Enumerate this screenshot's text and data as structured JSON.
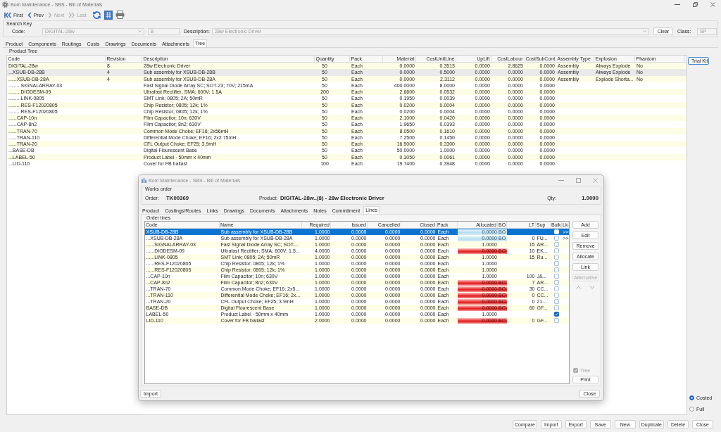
{
  "window": {
    "title": "Bom Maintenance - SBS - Bill of Materials"
  },
  "toolbar": [
    {
      "kind": "first",
      "label": "First",
      "disabled": false
    },
    {
      "kind": "prev",
      "label": "Prev",
      "disabled": false
    },
    {
      "kind": "next",
      "label": "Next",
      "disabled": true
    },
    {
      "kind": "last",
      "label": "Last",
      "disabled": true
    }
  ],
  "search_key": {
    "title": "Search Key",
    "code": {
      "label": "Code:",
      "value": "DIGITAL-28w",
      "disabled": true
    },
    "revision": {
      "value": "8",
      "disabled": true
    },
    "description": {
      "label": "Description:",
      "value": "28w Electronic Driver",
      "disabled": true
    },
    "clear_button": "Clear",
    "class": {
      "label": "Class:",
      "value": "SP",
      "disabled": true
    }
  },
  "tabs": [
    {
      "label": "Product",
      "selected": false
    },
    {
      "label": "Components",
      "selected": false
    },
    {
      "label": "Routings",
      "selected": false
    },
    {
      "label": "Costs",
      "selected": false
    },
    {
      "label": "Drawings",
      "selected": false
    },
    {
      "label": "Documents",
      "selected": false
    },
    {
      "label": "Attachments",
      "selected": false
    },
    {
      "label": "Tree",
      "selected": true
    }
  ],
  "product_tree": {
    "title": "Product Tree",
    "columns": [
      "Code",
      "Revision",
      "Description",
      "Quantity",
      "Pack",
      "Material",
      "CostUnitLine",
      "UpLift",
      "CostLabour",
      "CostSubCont",
      "Assembly Type",
      "Explosion",
      "Phantom"
    ],
    "rows": [
      {
        "code": "DIGITAL-28w",
        "revision": "8",
        "description": "28w Electronic Driver",
        "quantity": "50",
        "pack": "Each",
        "material": "0.0000",
        "cost_unit_line": "0.3513",
        "uplift": "0.0000",
        "cost_labour": "2.8625",
        "cost_sub_contract": "0.0000",
        "assembly_type": "Assembly",
        "explosion": "Always Explode",
        "phantom": "No",
        "selected": false,
        "children": [
          {
            "code": "...XSUB-DB-28B",
            "revision": "4",
            "description": "Sub assembly for XSUB-DB-28B",
            "quantity": "50",
            "pack": "Each",
            "material": "0.0000",
            "cost_unit_line": "0.5000",
            "uplift": "0.0000",
            "cost_labour": "0.0000",
            "cost_sub_contract": "0.0000",
            "assembly_type": "Assembly",
            "explosion": "Always Explode",
            "phantom": "No",
            "selected": true,
            "children": [
              {
                "code": "......XSUB-DB-28A",
                "revision": "4",
                "description": "Sub assembly for XSUB-DB-28A",
                "quantity": "50",
                "pack": "Each",
                "material": "0.0000",
                "cost_unit_line": "2.3112",
                "uplift": "0.0000",
                "cost_labour": "0.0000",
                "cost_sub_contract": "0.0000",
                "assembly_type": "Assembly",
                "explosion": "Explode Shorta...",
                "phantom": "No",
                "selected": false,
                "children": [
                  {
                    "code": ".........SIGNALARRAY-03",
                    "description": "Fast Signal Diode Array SC; SOT-23; 70V; 215mA",
                    "quantity": "50",
                    "pack": "Each",
                    "material": "400.0000",
                    "cost_unit_line": "8.0000",
                    "uplift": "0.0000",
                    "cost_labour": "0.0000",
                    "cost_sub_contract": "0.0000",
                    "selected": false
                  },
                  {
                    "code": ".........DIODESM-09",
                    "description": "Ultrafast Rectifier; SMA; 600V; 1.5A",
                    "quantity": "200",
                    "pack": "Each",
                    "material": "2.6600",
                    "cost_unit_line": "0.0532",
                    "uplift": "0.0000",
                    "cost_labour": "0.0000",
                    "cost_sub_contract": "0.0000",
                    "selected": false
                  },
                  {
                    "code": ".........LINK-0805",
                    "description": "SMT Link; 0805; 2A; 50mR",
                    "quantity": "50",
                    "pack": "Each",
                    "material": "0.1950",
                    "cost_unit_line": "0.0039",
                    "uplift": "0.0000",
                    "cost_labour": "0.0000",
                    "cost_sub_contract": "0.0000",
                    "selected": false
                  },
                  {
                    "code": ".........RES-F12020805",
                    "description": "Chip Resistor; 0805; 12k; 1%",
                    "quantity": "50",
                    "pack": "Each",
                    "material": "0.0200",
                    "cost_unit_line": "0.0004",
                    "uplift": "0.0000",
                    "cost_labour": "0.0000",
                    "cost_sub_contract": "0.0000",
                    "selected": false
                  },
                  {
                    "code": ".........RES-F12020805",
                    "description": "Chip Resistor; 0805; 12k; 1%",
                    "quantity": "50",
                    "pack": "Each",
                    "material": "0.0200",
                    "cost_unit_line": "0.0004",
                    "uplift": "0.0000",
                    "cost_labour": "0.0000",
                    "cost_sub_contract": "0.0000",
                    "selected": false
                  }
                ]
              },
              {
                "code": "......CAP-10n",
                "description": "Film Capacitor; 10n; 630V",
                "quantity": "50",
                "pack": "Each",
                "material": "2.1000",
                "cost_unit_line": "0.0420",
                "uplift": "0.0000",
                "cost_labour": "0.0000",
                "cost_sub_contract": "0.0000",
                "selected": false
              },
              {
                "code": "......CAP-8n2",
                "description": "Film Capacitor; 8n2; 630V",
                "quantity": "50",
                "pack": "Each",
                "material": "1.9650",
                "cost_unit_line": "0.0393",
                "uplift": "0.0000",
                "cost_labour": "0.0000",
                "cost_sub_contract": "0.0000",
                "selected": false
              },
              {
                "code": "......TRAN-70",
                "description": "Common Mode Choke; EF16; 2x56mH",
                "quantity": "50",
                "pack": "Each",
                "material": "8.0500",
                "cost_unit_line": "0.1610",
                "uplift": "0.0000",
                "cost_labour": "0.0000",
                "cost_sub_contract": "0.0000",
                "selected": false
              },
              {
                "code": "......TRAN-110",
                "description": "Differential Mode Choke; EF16; 2x2.75mH",
                "quantity": "50",
                "pack": "Each",
                "material": "7.2500",
                "cost_unit_line": "0.1450",
                "uplift": "0.0000",
                "cost_labour": "0.0000",
                "cost_sub_contract": "0.0000",
                "selected": false
              },
              {
                "code": "......TRAN-20",
                "description": "CFL Output Choke; EF25; 3.9mH",
                "quantity": "50",
                "pack": "Each",
                "material": "16.5000",
                "cost_unit_line": "0.3300",
                "uplift": "0.0000",
                "cost_labour": "0.0000",
                "cost_sub_contract": "0.0000",
                "selected": false
              }
            ]
          },
          {
            "code": "...BASE-DB",
            "description": "Digital Flourescent Base",
            "quantity": "50",
            "pack": "Each",
            "material": "50.0000",
            "cost_unit_line": "1.0000",
            "uplift": "0.0000",
            "cost_labour": "0.0000",
            "cost_sub_contract": "0.0000",
            "selected": false
          },
          {
            "code": "...LABEL-50",
            "description": "Product Label - 50mm x 40mm",
            "quantity": "50",
            "pack": "Each",
            "material": "0.3050",
            "cost_unit_line": "0.0061",
            "uplift": "0.0000",
            "cost_labour": "0.0000",
            "cost_sub_contract": "0.0000",
            "selected": false
          },
          {
            "code": "...LID-110",
            "description": "Cover for FB ballast",
            "quantity": "100",
            "pack": "Each",
            "material": "19.7400",
            "cost_unit_line": "0.3948",
            "uplift": "0.0000",
            "cost_labour": "0.0000",
            "cost_sub_contract": "0.0000",
            "selected": false
          }
        ]
      }
    ]
  },
  "trial_kit_button": "Trial Kit",
  "view_options": [
    {
      "label": "Costed",
      "selected": true
    },
    {
      "label": "Full",
      "selected": false
    }
  ],
  "bottom_buttons": [
    "Compare",
    "Import",
    "Export",
    "Save",
    "New",
    "Duplicate",
    "Delete",
    "Close"
  ],
  "dialog": {
    "title": "Bom Maintenance - SBS - Bill of Materials",
    "works_order": {
      "title": "Works order",
      "order_label": "Order:",
      "order": "TK00369",
      "product_label": "Product:",
      "product": "DIGITAL-28w..(8) - 28w Electronic Driver",
      "qty_label": "Qty:",
      "qty": "1.0000"
    },
    "tabs": [
      {
        "label": "Product",
        "selected": false
      },
      {
        "label": "Costings/Routes",
        "selected": false
      },
      {
        "label": "Links",
        "selected": false
      },
      {
        "label": "Drawings",
        "selected": false
      },
      {
        "label": "Documents",
        "selected": false
      },
      {
        "label": "Attachments",
        "selected": false
      },
      {
        "label": "Notes",
        "selected": false
      },
      {
        "label": "Commitment",
        "selected": false
      },
      {
        "label": "Lines",
        "selected": true
      }
    ],
    "order_lines": {
      "title": "Order lines",
      "columns": [
        "Code",
        "Name",
        "Required",
        "Issued",
        "Cancelled",
        "Closed",
        "Pack",
        "Allocated",
        "BO",
        "LT",
        "Sup",
        "Bulk",
        "Lk"
      ],
      "rows": [
        {
          "kind": "works_order",
          "code": "XSUB-DB-28B",
          "name": "Sub assembly for XSUB-DB-28B",
          "required": "1.0000",
          "issued": "0.0000",
          "cancelled": "0.0000",
          "closed": "0.0000",
          "pack": "Each",
          "allocated": "0.0000",
          "bo": "BO",
          "bulk": false,
          "link": ">>",
          "selected": true,
          "children": [
            {
              "kind": "works_order",
              "code": "...XSUB-DB-28A",
              "name": "Sub assembly for XSUB-DB-28A",
              "required": "1.0000",
              "issued": "0.0000",
              "cancelled": "0.0000",
              "closed": "0.0000",
              "pack": "Each",
              "allocated": "0.0000",
              "bo": "BO",
              "lead_time": "0",
              "supplier": "FU...",
              "bulk": false,
              "link": ">>",
              "selected": false,
              "children": [
                {
                  "kind": "plain",
                  "code": "......SIGNALARRAY-03",
                  "name": "Fast Signal Diode Array SC; SOT-...",
                  "required": "1.0000",
                  "issued": "0.0000",
                  "cancelled": "0.0000",
                  "closed": "0.0000",
                  "pack": "Each",
                  "allocated": "1.0000",
                  "lead_time": "15",
                  "supplier": "AR...",
                  "bulk": false,
                  "selected": false
                },
                {
                  "kind": "backorder",
                  "code": "......DIODESM-09",
                  "name": "Ultrafast Rectifier; SMA; 600V; 1.5...",
                  "required": "4.0000",
                  "issued": "0.0000",
                  "cancelled": "0.0000",
                  "closed": "0.0000",
                  "pack": "Each",
                  "allocated": "0.0000",
                  "bo": "BO",
                  "lead_time": "10",
                  "supplier": "EK...",
                  "bulk": false,
                  "selected": false
                },
                {
                  "kind": "plain",
                  "code": "......LINK-0805",
                  "name": "SMT Link; 0805; 2A; 50mR",
                  "required": "1.0000",
                  "issued": "0.0000",
                  "cancelled": "0.0000",
                  "closed": "0.0000",
                  "pack": "Each",
                  "allocated": "1.0000",
                  "lead_time": "15",
                  "supplier": "Ru...",
                  "bulk": false,
                  "selected": false
                },
                {
                  "kind": "plain",
                  "code": "......RES-F12020805",
                  "name": "Chip Resistor; 0805; 12k; 1%",
                  "required": "1.0000",
                  "issued": "0.0000",
                  "cancelled": "0.0000",
                  "closed": "0.0000",
                  "pack": "Each",
                  "allocated": "1.0000",
                  "bulk": false,
                  "selected": false
                },
                {
                  "kind": "plain",
                  "code": "......RES-F12020805",
                  "name": "Chip Resistor; 0805; 12k; 1%",
                  "required": "1.0000",
                  "issued": "0.0000",
                  "cancelled": "0.0000",
                  "closed": "0.0000",
                  "pack": "Each",
                  "allocated": "1.0000",
                  "bulk": false,
                  "selected": false
                }
              ]
            },
            {
              "kind": "plain",
              "code": "...CAP-10n",
              "name": "Film Capacitor; 10n; 630V",
              "required": "1.0000",
              "issued": "0.0000",
              "cancelled": "0.0000",
              "closed": "0.0000",
              "pack": "Each",
              "allocated": "1.0000",
              "lead_time": "100",
              "supplier": "J&...",
              "bulk": false,
              "selected": false
            },
            {
              "kind": "backorder",
              "code": "...CAP-8n2",
              "name": "Film Capacitor; 8n2; 630V",
              "required": "1.0000",
              "issued": "0.0000",
              "cancelled": "0.0000",
              "closed": "0.0000",
              "pack": "Each",
              "allocated": "0.0000",
              "bo": "BO",
              "lead_time": "7",
              "supplier": "AR...",
              "bulk": false,
              "selected": false
            },
            {
              "kind": "backorder",
              "code": "...TRAN-70",
              "name": "Common Mode Choke; EF16; 2x5...",
              "required": "1.0000",
              "issued": "0.0000",
              "cancelled": "0.0000",
              "closed": "0.0000",
              "pack": "Each",
              "allocated": "0.0000",
              "bo": "BO",
              "lead_time": "30",
              "supplier": "CC...",
              "bulk": false,
              "selected": false
            },
            {
              "kind": "backorder",
              "code": "...TRAN-110",
              "name": "Differential Mode Choke; EF16; 2x...",
              "required": "1.0000",
              "issued": "0.0000",
              "cancelled": "0.0000",
              "closed": "0.0000",
              "pack": "Each",
              "allocated": "0.0000",
              "bo": "BO",
              "lead_time": "0",
              "supplier": "CC...",
              "bulk": false,
              "selected": false
            },
            {
              "kind": "backorder",
              "code": "...TRAN-20",
              "name": "CFL Output Choke; EF25; 3.9mH",
              "required": "1.0000",
              "issued": "0.0000",
              "cancelled": "0.0000",
              "closed": "0.0000",
              "pack": "Each",
              "allocated": "0.0000",
              "bo": "BO",
              "lead_time": "0",
              "supplier": "21...",
              "bulk": false,
              "selected": false
            }
          ]
        },
        {
          "kind": "backorder",
          "code": "BASE-DB",
          "name": "Digital Flourescent Base",
          "required": "1.0000",
          "issued": "0.0000",
          "cancelled": "0.0000",
          "closed": "0.0000",
          "pack": "Each",
          "allocated": "0.0000",
          "bo": "BO",
          "lead_time": "60",
          "supplier": "GF...",
          "bulk": false,
          "selected": false
        },
        {
          "kind": "plain",
          "code": "LABEL-50",
          "name": "Product Label - 50mm x 40mm",
          "required": "1.0000",
          "issued": "0.0000",
          "cancelled": "0.0000",
          "closed": "0.0000",
          "pack": "Each",
          "allocated": "1.0000",
          "bulk": true,
          "selected": false
        },
        {
          "kind": "backorder",
          "code": "LID-110",
          "name": "Cover for FB ballast",
          "required": "2.0000",
          "issued": "0.0000",
          "cancelled": "0.0000",
          "closed": "0.0000",
          "pack": "Each",
          "allocated": "0.0000",
          "bo": "BO",
          "lead_time": "0",
          "supplier": "GF...",
          "bulk": false,
          "selected": false
        }
      ]
    },
    "side_buttons": [
      {
        "label": "Add",
        "disabled": false
      },
      {
        "label": "Edit",
        "disabled": false
      },
      {
        "label": "Remove",
        "disabled": false
      },
      {
        "label": "Allocate",
        "disabled": false
      },
      {
        "label": "Link",
        "disabled": false
      },
      {
        "label": "Alternative",
        "disabled": true
      }
    ],
    "tree_checkbox": {
      "label": "Tree",
      "checked": true,
      "disabled": true
    },
    "print_button": "Print",
    "import_button": "Import",
    "close_button": "Close"
  }
}
